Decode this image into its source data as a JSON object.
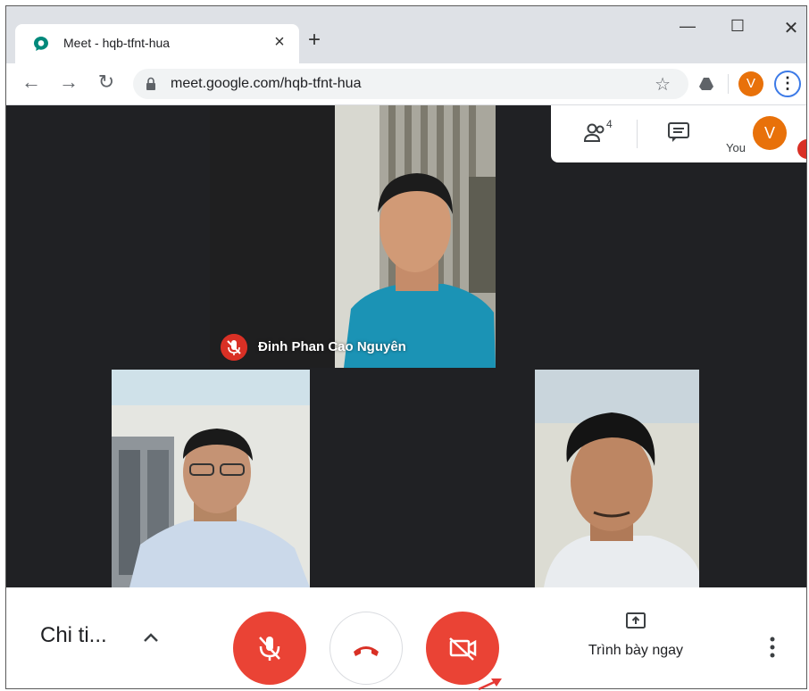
{
  "browser": {
    "tab_title": "Meet - hqb-tfnt-hua",
    "url": "meet.google.com/hqb-tfnt-hua",
    "profile_initial": "V",
    "accent": "#e8710a"
  },
  "meeting": {
    "participant_count": "4",
    "self_label": "You",
    "self_initial": "V",
    "speaker_name": "Đinh Phan Cao Nguyên",
    "details_label": "Chi ti...",
    "present_label": "Trình bày ngay",
    "control_color": "#ea4335"
  },
  "icons": [
    "meet-icon",
    "close-icon",
    "plus-icon",
    "minimize-icon",
    "maximize-icon",
    "back-icon",
    "forward-icon",
    "reload-icon",
    "lock-icon",
    "star-icon",
    "extension-icon",
    "people-icon",
    "chat-icon",
    "mic-off-icon",
    "chevron-up-icon",
    "hang-up-icon",
    "camera-off-icon",
    "present-icon",
    "more-vert-icon"
  ]
}
